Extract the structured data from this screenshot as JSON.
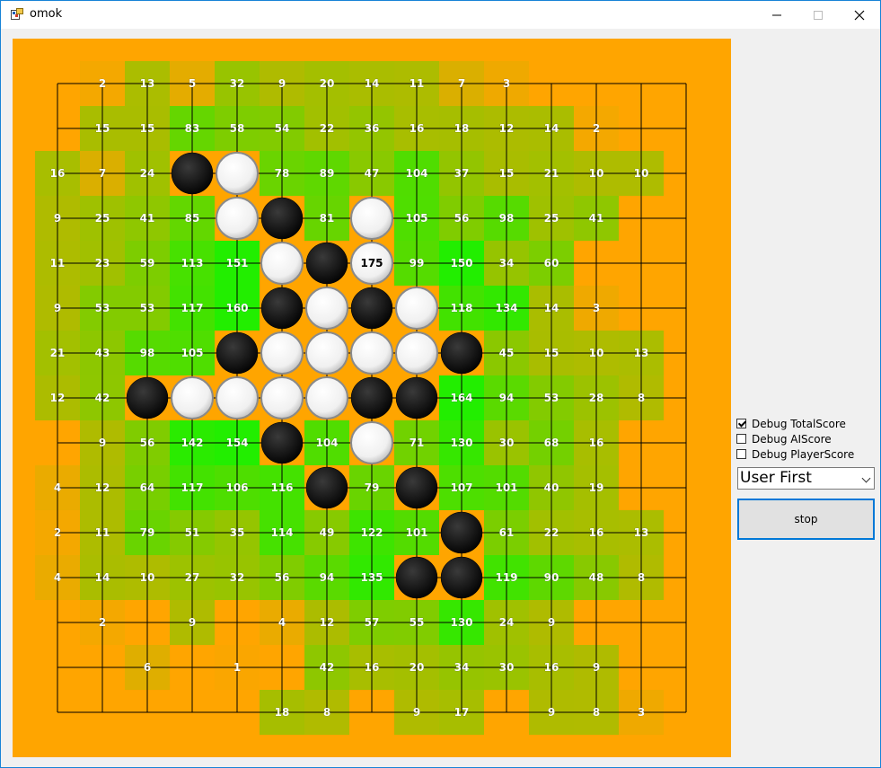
{
  "window": {
    "title": "omok",
    "minimize_icon": "minimize-icon",
    "maximize_icon": "maximize-icon",
    "close_icon": "close-icon"
  },
  "colors": {
    "board": "#ffa500",
    "line": "#000000",
    "accent": "#0078d7",
    "heat_low": "#b8b800",
    "heat_high": "#22ee00"
  },
  "board": {
    "size": 15,
    "stones": [
      {
        "r": 2,
        "c": 3,
        "color": "black"
      },
      {
        "r": 2,
        "c": 4,
        "color": "white"
      },
      {
        "r": 3,
        "c": 4,
        "color": "white"
      },
      {
        "r": 3,
        "c": 5,
        "color": "black"
      },
      {
        "r": 3,
        "c": 7,
        "color": "white"
      },
      {
        "r": 4,
        "c": 5,
        "color": "white"
      },
      {
        "r": 4,
        "c": 6,
        "color": "black"
      },
      {
        "r": 4,
        "c": 7,
        "color": "white",
        "label": "175"
      },
      {
        "r": 5,
        "c": 5,
        "color": "black"
      },
      {
        "r": 5,
        "c": 6,
        "color": "white"
      },
      {
        "r": 5,
        "c": 7,
        "color": "black"
      },
      {
        "r": 5,
        "c": 8,
        "color": "white"
      },
      {
        "r": 6,
        "c": 4,
        "color": "black"
      },
      {
        "r": 6,
        "c": 5,
        "color": "white"
      },
      {
        "r": 6,
        "c": 6,
        "color": "white"
      },
      {
        "r": 6,
        "c": 7,
        "color": "white"
      },
      {
        "r": 6,
        "c": 8,
        "color": "white"
      },
      {
        "r": 6,
        "c": 9,
        "color": "black"
      },
      {
        "r": 7,
        "c": 2,
        "color": "black"
      },
      {
        "r": 7,
        "c": 3,
        "color": "white"
      },
      {
        "r": 7,
        "c": 4,
        "color": "white"
      },
      {
        "r": 7,
        "c": 5,
        "color": "white"
      },
      {
        "r": 7,
        "c": 6,
        "color": "white"
      },
      {
        "r": 7,
        "c": 7,
        "color": "black"
      },
      {
        "r": 7,
        "c": 8,
        "color": "black"
      },
      {
        "r": 8,
        "c": 5,
        "color": "black"
      },
      {
        "r": 8,
        "c": 7,
        "color": "white"
      },
      {
        "r": 9,
        "c": 6,
        "color": "black"
      },
      {
        "r": 9,
        "c": 8,
        "color": "black"
      },
      {
        "r": 10,
        "c": 9,
        "color": "black"
      },
      {
        "r": 11,
        "c": 8,
        "color": "black"
      },
      {
        "r": 11,
        "c": 9,
        "color": "black"
      }
    ],
    "scores": [
      {
        "r": 0,
        "c": 1,
        "v": "2"
      },
      {
        "r": 0,
        "c": 2,
        "v": "13"
      },
      {
        "r": 0,
        "c": 3,
        "v": "5"
      },
      {
        "r": 0,
        "c": 4,
        "v": "32"
      },
      {
        "r": 0,
        "c": 5,
        "v": "9"
      },
      {
        "r": 0,
        "c": 6,
        "v": "20"
      },
      {
        "r": 0,
        "c": 7,
        "v": "14"
      },
      {
        "r": 0,
        "c": 8,
        "v": "11"
      },
      {
        "r": 0,
        "c": 9,
        "v": "7"
      },
      {
        "r": 0,
        "c": 10,
        "v": "3"
      },
      {
        "r": 1,
        "c": 1,
        "v": "15"
      },
      {
        "r": 1,
        "c": 2,
        "v": "15"
      },
      {
        "r": 1,
        "c": 3,
        "v": "83"
      },
      {
        "r": 1,
        "c": 4,
        "v": "58"
      },
      {
        "r": 1,
        "c": 5,
        "v": "54"
      },
      {
        "r": 1,
        "c": 6,
        "v": "22"
      },
      {
        "r": 1,
        "c": 7,
        "v": "36"
      },
      {
        "r": 1,
        "c": 8,
        "v": "16"
      },
      {
        "r": 1,
        "c": 9,
        "v": "18"
      },
      {
        "r": 1,
        "c": 10,
        "v": "12"
      },
      {
        "r": 1,
        "c": 11,
        "v": "14"
      },
      {
        "r": 1,
        "c": 12,
        "v": "2"
      },
      {
        "r": 2,
        "c": 0,
        "v": "16"
      },
      {
        "r": 2,
        "c": 1,
        "v": "7"
      },
      {
        "r": 2,
        "c": 2,
        "v": "24"
      },
      {
        "r": 2,
        "c": 5,
        "v": "78"
      },
      {
        "r": 2,
        "c": 6,
        "v": "89"
      },
      {
        "r": 2,
        "c": 7,
        "v": "47"
      },
      {
        "r": 2,
        "c": 8,
        "v": "104"
      },
      {
        "r": 2,
        "c": 9,
        "v": "37"
      },
      {
        "r": 2,
        "c": 10,
        "v": "15"
      },
      {
        "r": 2,
        "c": 11,
        "v": "21"
      },
      {
        "r": 2,
        "c": 12,
        "v": "10"
      },
      {
        "r": 2,
        "c": 13,
        "v": "10"
      },
      {
        "r": 3,
        "c": 0,
        "v": "9"
      },
      {
        "r": 3,
        "c": 1,
        "v": "25"
      },
      {
        "r": 3,
        "c": 2,
        "v": "41"
      },
      {
        "r": 3,
        "c": 3,
        "v": "85"
      },
      {
        "r": 3,
        "c": 6,
        "v": "81"
      },
      {
        "r": 3,
        "c": 8,
        "v": "105"
      },
      {
        "r": 3,
        "c": 9,
        "v": "56"
      },
      {
        "r": 3,
        "c": 10,
        "v": "98"
      },
      {
        "r": 3,
        "c": 11,
        "v": "25"
      },
      {
        "r": 3,
        "c": 12,
        "v": "41"
      },
      {
        "r": 4,
        "c": 0,
        "v": "11"
      },
      {
        "r": 4,
        "c": 1,
        "v": "23"
      },
      {
        "r": 4,
        "c": 2,
        "v": "59"
      },
      {
        "r": 4,
        "c": 3,
        "v": "113"
      },
      {
        "r": 4,
        "c": 4,
        "v": "151"
      },
      {
        "r": 4,
        "c": 8,
        "v": "99"
      },
      {
        "r": 4,
        "c": 9,
        "v": "150"
      },
      {
        "r": 4,
        "c": 10,
        "v": "34"
      },
      {
        "r": 4,
        "c": 11,
        "v": "60"
      },
      {
        "r": 5,
        "c": 0,
        "v": "9"
      },
      {
        "r": 5,
        "c": 1,
        "v": "53"
      },
      {
        "r": 5,
        "c": 2,
        "v": "53"
      },
      {
        "r": 5,
        "c": 3,
        "v": "117"
      },
      {
        "r": 5,
        "c": 4,
        "v": "160"
      },
      {
        "r": 5,
        "c": 9,
        "v": "118"
      },
      {
        "r": 5,
        "c": 10,
        "v": "134"
      },
      {
        "r": 5,
        "c": 11,
        "v": "14"
      },
      {
        "r": 5,
        "c": 12,
        "v": "3"
      },
      {
        "r": 6,
        "c": 0,
        "v": "21"
      },
      {
        "r": 6,
        "c": 1,
        "v": "43"
      },
      {
        "r": 6,
        "c": 2,
        "v": "98"
      },
      {
        "r": 6,
        "c": 3,
        "v": "105"
      },
      {
        "r": 6,
        "c": 10,
        "v": "45"
      },
      {
        "r": 6,
        "c": 11,
        "v": "15"
      },
      {
        "r": 6,
        "c": 12,
        "v": "10"
      },
      {
        "r": 6,
        "c": 13,
        "v": "13"
      },
      {
        "r": 7,
        "c": 0,
        "v": "12"
      },
      {
        "r": 7,
        "c": 1,
        "v": "42"
      },
      {
        "r": 7,
        "c": 9,
        "v": "164"
      },
      {
        "r": 7,
        "c": 10,
        "v": "94"
      },
      {
        "r": 7,
        "c": 11,
        "v": "53"
      },
      {
        "r": 7,
        "c": 12,
        "v": "28"
      },
      {
        "r": 7,
        "c": 13,
        "v": "8"
      },
      {
        "r": 8,
        "c": 1,
        "v": "9"
      },
      {
        "r": 8,
        "c": 2,
        "v": "56"
      },
      {
        "r": 8,
        "c": 3,
        "v": "142"
      },
      {
        "r": 8,
        "c": 4,
        "v": "154"
      },
      {
        "r": 8,
        "c": 6,
        "v": "104"
      },
      {
        "r": 8,
        "c": 8,
        "v": "71"
      },
      {
        "r": 8,
        "c": 9,
        "v": "130"
      },
      {
        "r": 8,
        "c": 10,
        "v": "30"
      },
      {
        "r": 8,
        "c": 11,
        "v": "68"
      },
      {
        "r": 8,
        "c": 12,
        "v": "16"
      },
      {
        "r": 9,
        "c": 0,
        "v": "4"
      },
      {
        "r": 9,
        "c": 1,
        "v": "12"
      },
      {
        "r": 9,
        "c": 2,
        "v": "64"
      },
      {
        "r": 9,
        "c": 3,
        "v": "117"
      },
      {
        "r": 9,
        "c": 4,
        "v": "106"
      },
      {
        "r": 9,
        "c": 5,
        "v": "116"
      },
      {
        "r": 9,
        "c": 7,
        "v": "79"
      },
      {
        "r": 9,
        "c": 9,
        "v": "107"
      },
      {
        "r": 9,
        "c": 10,
        "v": "101"
      },
      {
        "r": 9,
        "c": 11,
        "v": "40"
      },
      {
        "r": 9,
        "c": 12,
        "v": "19"
      },
      {
        "r": 10,
        "c": 0,
        "v": "2"
      },
      {
        "r": 10,
        "c": 1,
        "v": "11"
      },
      {
        "r": 10,
        "c": 2,
        "v": "79"
      },
      {
        "r": 10,
        "c": 3,
        "v": "51"
      },
      {
        "r": 10,
        "c": 4,
        "v": "35"
      },
      {
        "r": 10,
        "c": 5,
        "v": "114"
      },
      {
        "r": 10,
        "c": 6,
        "v": "49"
      },
      {
        "r": 10,
        "c": 7,
        "v": "122"
      },
      {
        "r": 10,
        "c": 8,
        "v": "101"
      },
      {
        "r": 10,
        "c": 10,
        "v": "61"
      },
      {
        "r": 10,
        "c": 11,
        "v": "22"
      },
      {
        "r": 10,
        "c": 12,
        "v": "16"
      },
      {
        "r": 10,
        "c": 13,
        "v": "13"
      },
      {
        "r": 11,
        "c": 0,
        "v": "4"
      },
      {
        "r": 11,
        "c": 1,
        "v": "14"
      },
      {
        "r": 11,
        "c": 2,
        "v": "10"
      },
      {
        "r": 11,
        "c": 3,
        "v": "27"
      },
      {
        "r": 11,
        "c": 4,
        "v": "32"
      },
      {
        "r": 11,
        "c": 5,
        "v": "56"
      },
      {
        "r": 11,
        "c": 6,
        "v": "94"
      },
      {
        "r": 11,
        "c": 7,
        "v": "135"
      },
      {
        "r": 11,
        "c": 10,
        "v": "119"
      },
      {
        "r": 11,
        "c": 11,
        "v": "90"
      },
      {
        "r": 11,
        "c": 12,
        "v": "48"
      },
      {
        "r": 11,
        "c": 13,
        "v": "8"
      },
      {
        "r": 12,
        "c": 1,
        "v": "2"
      },
      {
        "r": 12,
        "c": 3,
        "v": "9"
      },
      {
        "r": 12,
        "c": 5,
        "v": "4"
      },
      {
        "r": 12,
        "c": 6,
        "v": "12"
      },
      {
        "r": 12,
        "c": 7,
        "v": "57"
      },
      {
        "r": 12,
        "c": 8,
        "v": "55"
      },
      {
        "r": 12,
        "c": 9,
        "v": "130"
      },
      {
        "r": 12,
        "c": 10,
        "v": "24"
      },
      {
        "r": 12,
        "c": 11,
        "v": "9"
      },
      {
        "r": 13,
        "c": 2,
        "v": "6"
      },
      {
        "r": 13,
        "c": 4,
        "v": "1"
      },
      {
        "r": 13,
        "c": 6,
        "v": "42"
      },
      {
        "r": 13,
        "c": 7,
        "v": "16"
      },
      {
        "r": 13,
        "c": 8,
        "v": "20"
      },
      {
        "r": 13,
        "c": 9,
        "v": "34"
      },
      {
        "r": 13,
        "c": 10,
        "v": "30"
      },
      {
        "r": 13,
        "c": 11,
        "v": "16"
      },
      {
        "r": 13,
        "c": 12,
        "v": "9"
      },
      {
        "r": 14,
        "c": 5,
        "v": "18"
      },
      {
        "r": 14,
        "c": 6,
        "v": "8"
      },
      {
        "r": 14,
        "c": 8,
        "v": "9"
      },
      {
        "r": 14,
        "c": 9,
        "v": "17"
      },
      {
        "r": 14,
        "c": 11,
        "v": "9"
      },
      {
        "r": 14,
        "c": 12,
        "v": "8"
      },
      {
        "r": 14,
        "c": 13,
        "v": "3"
      }
    ]
  },
  "controls": {
    "debug_total": {
      "label": "Debug TotalScore",
      "checked": true
    },
    "debug_ai": {
      "label": "Debug AIScore",
      "checked": false
    },
    "debug_player": {
      "label": "Debug PlayerScore",
      "checked": false
    },
    "order_select": {
      "value": "User First"
    },
    "stop_button": {
      "label": "stop"
    }
  }
}
